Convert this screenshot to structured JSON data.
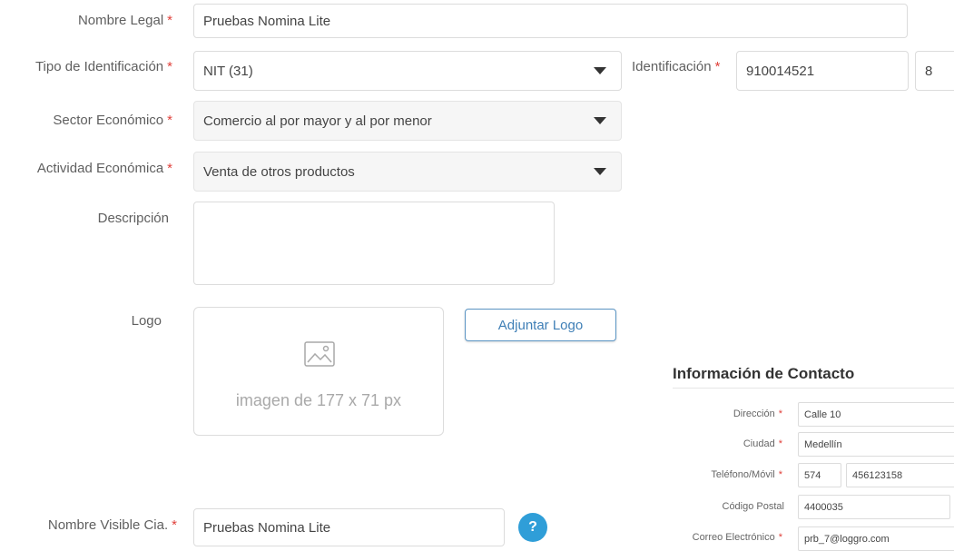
{
  "form": {
    "legal_name": {
      "label": "Nombre Legal",
      "required": "*",
      "value": "Pruebas Nomina Lite"
    },
    "id_type": {
      "label": "Tipo de Identificación",
      "required": "*",
      "value": "NIT (31)"
    },
    "identification": {
      "label": "Identificación",
      "required": "*",
      "value": "910014521",
      "check_digit": "8"
    },
    "economic_sector": {
      "label": "Sector Económico",
      "required": "*",
      "value": "Comercio al por mayor y al por menor"
    },
    "economic_activity": {
      "label": "Actividad Económica",
      "required": "*",
      "value": "Venta de otros productos"
    },
    "description": {
      "label": "Descripción",
      "value": ""
    },
    "logo": {
      "label": "Logo",
      "placeholder": "imagen de 177 x 71 px",
      "attach_button": "Adjuntar Logo"
    },
    "visible_name": {
      "label": "Nombre Visible Cia.",
      "required": "*",
      "value": "Pruebas Nomina Lite",
      "help": "?"
    }
  },
  "contact": {
    "title": "Información de Contacto",
    "address": {
      "label": "Dirección",
      "required": "*",
      "value": "Calle 10"
    },
    "city": {
      "label": "Ciudad",
      "required": "*",
      "value": "Medellín"
    },
    "phone": {
      "label": "Teléfono/Móvil",
      "required": "*",
      "prefix": "574",
      "value": "456123158"
    },
    "postal_code": {
      "label": "Código Postal",
      "value": "4400035"
    },
    "email": {
      "label": "Correo Electrónico",
      "required": "*",
      "value": "prb_7@loggro.com"
    }
  },
  "colors": {
    "required_star": "#e0403a",
    "accent": "#3f7fb6",
    "help_button": "#2f9ed8"
  },
  "icons": [
    "caret-down-icon",
    "image-placeholder-icon",
    "question-icon"
  ]
}
